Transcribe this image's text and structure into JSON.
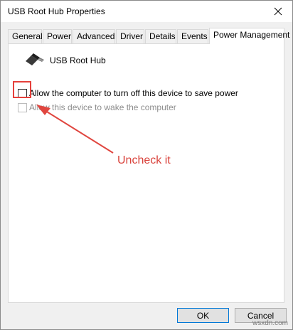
{
  "window": {
    "title": "USB Root Hub Properties",
    "close_icon": "close-icon"
  },
  "tabs": [
    {
      "label": "General"
    },
    {
      "label": "Power"
    },
    {
      "label": "Advanced"
    },
    {
      "label": "Driver"
    },
    {
      "label": "Details"
    },
    {
      "label": "Events"
    },
    {
      "label": "Power Management",
      "active": true
    }
  ],
  "device": {
    "name": "USB Root Hub",
    "icon": "usb-connector-icon"
  },
  "options": [
    {
      "label": "Allow the computer to turn off this device to save power",
      "checked": false,
      "enabled": true
    },
    {
      "label": "Allow this device to wake the computer",
      "checked": false,
      "enabled": false
    }
  ],
  "annotation": {
    "text": "Uncheck it",
    "color": "#d9423b"
  },
  "buttons": {
    "ok": "OK",
    "cancel": "Cancel"
  },
  "watermark": "wsxdn.com"
}
